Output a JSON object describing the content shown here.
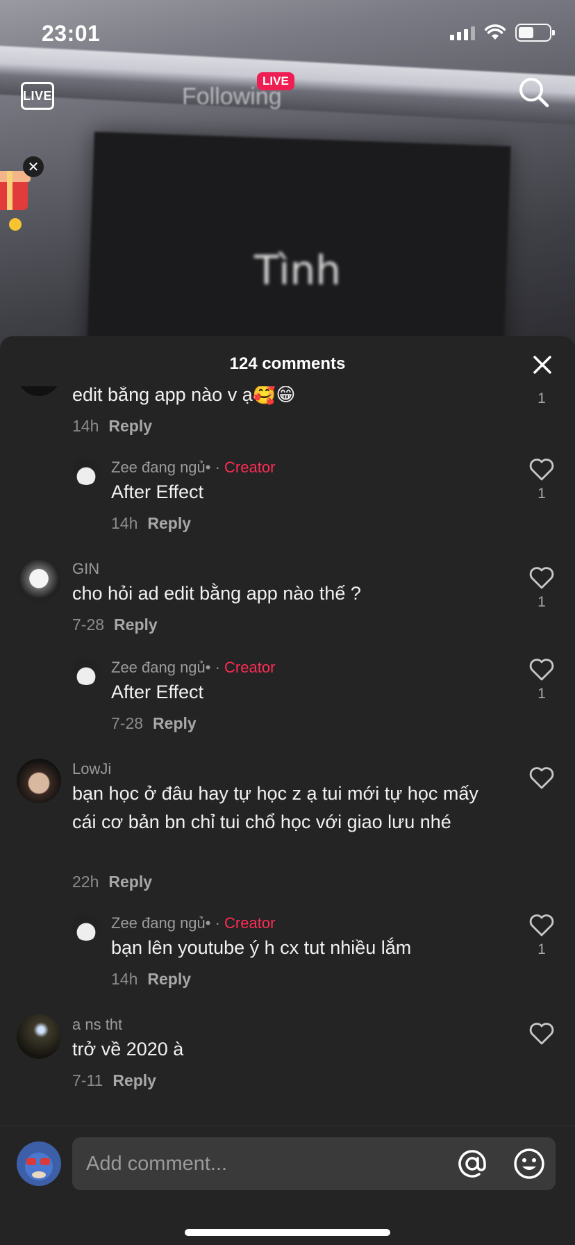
{
  "status_bar": {
    "time": "23:01"
  },
  "top_nav": {
    "live_icon_label": "LIVE",
    "live_badge": "LIVE",
    "following_label": "Following"
  },
  "video": {
    "overlay_text": "Tình"
  },
  "sheet": {
    "title": "124 comments"
  },
  "comments": [
    {
      "name": "",
      "text": "edit bằng app nào v ạ🥰😁",
      "time": "14h",
      "reply": "Reply",
      "likes": "1",
      "is_reply": false,
      "creator": false
    },
    {
      "name": "Zee đang ngủ•",
      "creator_label": "Creator",
      "text": "After Effect",
      "time": "14h",
      "reply": "Reply",
      "likes": "1",
      "is_reply": true,
      "creator": true
    },
    {
      "name": "GIN",
      "text": "cho hỏi ad edit bằng app nào thế ?",
      "time": "7-28",
      "reply": "Reply",
      "likes": "1",
      "is_reply": false,
      "creator": false
    },
    {
      "name": "Zee đang ngủ•",
      "creator_label": "Creator",
      "text": "After Effect",
      "time": "7-28",
      "reply": "Reply",
      "likes": "1",
      "is_reply": true,
      "creator": true
    },
    {
      "name": "LowJi",
      "text": "bạn học ở đâu hay tự học z ạ tui mới tự học mấy cái cơ bản bn chỉ tui chổ học với giao lưu nhé",
      "time": "22h",
      "reply": "Reply",
      "likes": "",
      "is_reply": false,
      "creator": false
    },
    {
      "name": "Zee đang ngủ•",
      "creator_label": "Creator",
      "text": "bạn lên youtube ý h cx tut nhiều lắm",
      "time": "14h",
      "reply": "Reply",
      "likes": "1",
      "is_reply": true,
      "creator": true
    },
    {
      "name": "a ns tht",
      "text": "trở về 2020 à",
      "time": "7-11",
      "reply": "Reply",
      "likes": "",
      "is_reply": false,
      "creator": false
    }
  ],
  "input": {
    "placeholder": "Add comment..."
  },
  "colors": {
    "sheet_bg": "#242424",
    "creator": "#fe2c55",
    "live_badge": "#ee1d52"
  },
  "icons": [
    "live-icon",
    "search-icon",
    "close-icon",
    "heart-icon",
    "at-icon",
    "emoji-icon",
    "gift-icon"
  ]
}
